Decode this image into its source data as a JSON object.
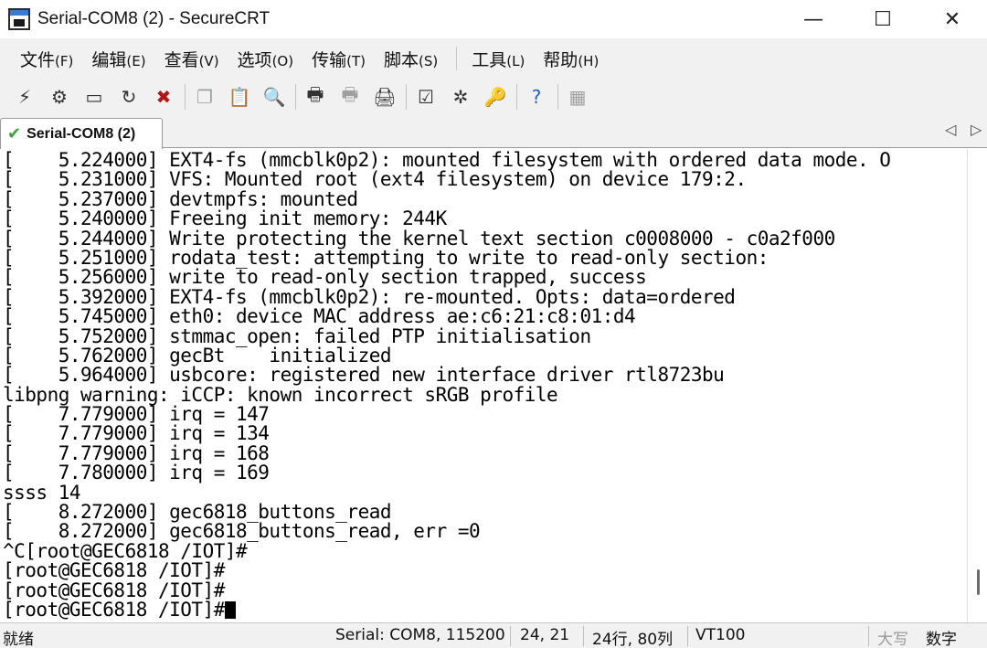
{
  "window": {
    "title": "Serial-COM8 (2) - SecureCRT",
    "minimize_glyph": "—",
    "maximize_glyph": "☐",
    "close_glyph": "✕"
  },
  "menu": [
    {
      "label": "文件",
      "accel": "(F)"
    },
    {
      "label": "编辑",
      "accel": "(E)"
    },
    {
      "label": "查看",
      "accel": "(V)"
    },
    {
      "label": "选项",
      "accel": "(O)"
    },
    {
      "label": "传输",
      "accel": "(T)"
    },
    {
      "label": "脚本",
      "accel": "(S)"
    },
    {
      "label": "工具",
      "accel": "(L)"
    },
    {
      "label": "帮助",
      "accel": "(H)"
    }
  ],
  "toolbar_icons": [
    "connect-icon",
    "quick-connect-icon",
    "connect-in-tab-icon",
    "reconnect-icon",
    "disconnect-icon",
    "copy-icon",
    "paste-icon",
    "find-icon",
    "print-setup-icon",
    "print-selection-icon",
    "print-icon",
    "session-options-icon",
    "global-options-icon",
    "keymap-icon",
    "help-icon",
    "lock-icon"
  ],
  "tab": {
    "label": "Serial-COM8 (2)",
    "prev_glyph": "◁",
    "next_glyph": "▷"
  },
  "terminal": {
    "lines": [
      "[    5.224000] EXT4-fs (mmcblk0p2): mounted filesystem with ordered data mode. O",
      "[    5.231000] VFS: Mounted root (ext4 filesystem) on device 179:2.",
      "[    5.237000] devtmpfs: mounted",
      "[    5.240000] Freeing init memory: 244K",
      "[    5.244000] Write protecting the kernel text section c0008000 - c0a2f000",
      "[    5.251000] rodata_test: attempting to write to read-only section:",
      "[    5.256000] write to read-only section trapped, success",
      "[    5.392000] EXT4-fs (mmcblk0p2): re-mounted. Opts: data=ordered",
      "[    5.745000] eth0: device MAC address ae:c6:21:c8:01:d4",
      "[    5.752000] stmmac_open: failed PTP initialisation",
      "[    5.762000] gecBt    initialized",
      "[    5.964000] usbcore: registered new interface driver rtl8723bu",
      "libpng warning: iCCP: known incorrect sRGB profile",
      "[    7.779000] irq = 147",
      "[    7.779000] irq = 134",
      "[    7.779000] irq = 168",
      "[    7.780000] irq = 169",
      "ssss 14",
      "[    8.272000] gec6818_buttons_read",
      "[    8.272000] gec6818_buttons_read, err =0",
      "^C[root@GEC6818 /IOT]#",
      "[root@GEC6818 /IOT]#",
      "[root@GEC6818 /IOT]#",
      "[root@GEC6818 /IOT]#"
    ]
  },
  "status": {
    "ready": "就绪",
    "connection": "Serial: COM8, 115200",
    "cursor_pos": "24,  21",
    "size": "24行, 80列",
    "emulation": "VT100",
    "caps": "大写",
    "num": "数字"
  }
}
